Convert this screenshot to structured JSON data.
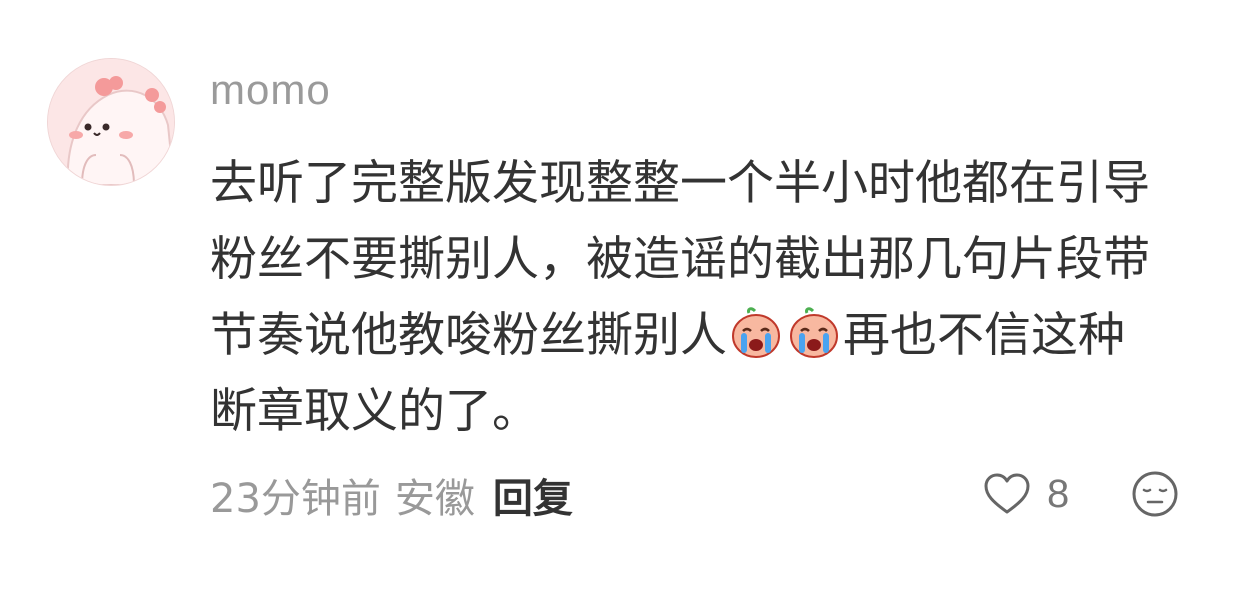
{
  "comment": {
    "username": "momo",
    "avatar_icon": "pink-bunny-avatar",
    "text_lines": [
      "去听了完整版发现整整一个半小时他都在引导",
      "粉丝不要撕别人，被造谣的截出那几句片段带",
      "节奏说他教唆粉丝撕别人",
      "再也不信这种",
      "断章取义的了。"
    ],
    "inline_emoji": "crying-emoji",
    "time": "23分钟前",
    "location": "安徽",
    "reply_label": "回复",
    "like_icon": "heart-outline-icon",
    "like_count": "8",
    "dislike_icon": "unhappy-face-icon"
  },
  "colors": {
    "username": "#9a9a9a",
    "body_text": "#333333",
    "meta_text": "#999999",
    "icon_stroke": "#666666",
    "avatar_bg": "#fbe4e4"
  }
}
